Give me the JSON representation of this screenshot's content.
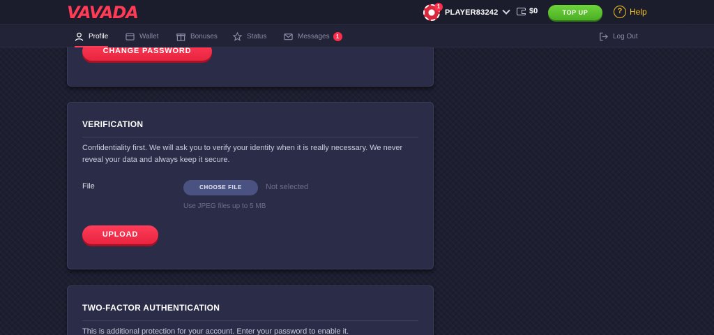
{
  "header": {
    "logo": "VAVADA",
    "username": "PLAYER83242",
    "avatar_badge": "1",
    "balance": "$0",
    "topup_label": "TOP UP",
    "help_label": "Help"
  },
  "nav": {
    "tabs": [
      {
        "label": "Profile",
        "icon": "user-icon",
        "active": true
      },
      {
        "label": "Wallet",
        "icon": "wallet-icon"
      },
      {
        "label": "Bonuses",
        "icon": "gift-icon"
      },
      {
        "label": "Status",
        "icon": "star-icon"
      },
      {
        "label": "Messages",
        "icon": "envelope-icon",
        "badge": "1"
      }
    ],
    "logout_label": "Log Out"
  },
  "password_card": {
    "change_password_label": "CHANGE PASSWORD"
  },
  "verification": {
    "title": "VERIFICATION",
    "description": "Confidentiality first. We will ask you to verify your identity when it is really necessary. We never reveal your data and always keep it secure.",
    "file_label": "File",
    "choose_file_label": "CHOOSE FILE",
    "file_status": "Not selected",
    "file_hint": "Use JPEG files up to 5 MB",
    "upload_label": "UPLOAD"
  },
  "two_factor": {
    "title": "TWO-FACTOR AUTHENTICATION",
    "description": "This is additional protection for your account. Enter your password to enable it."
  },
  "colors": {
    "accent_red": "#ff3b55",
    "topup_green": "#5cc22f",
    "help_yellow": "#f4c322",
    "card_bg": "#2b2d48",
    "page_bg": "#1d1e30"
  }
}
